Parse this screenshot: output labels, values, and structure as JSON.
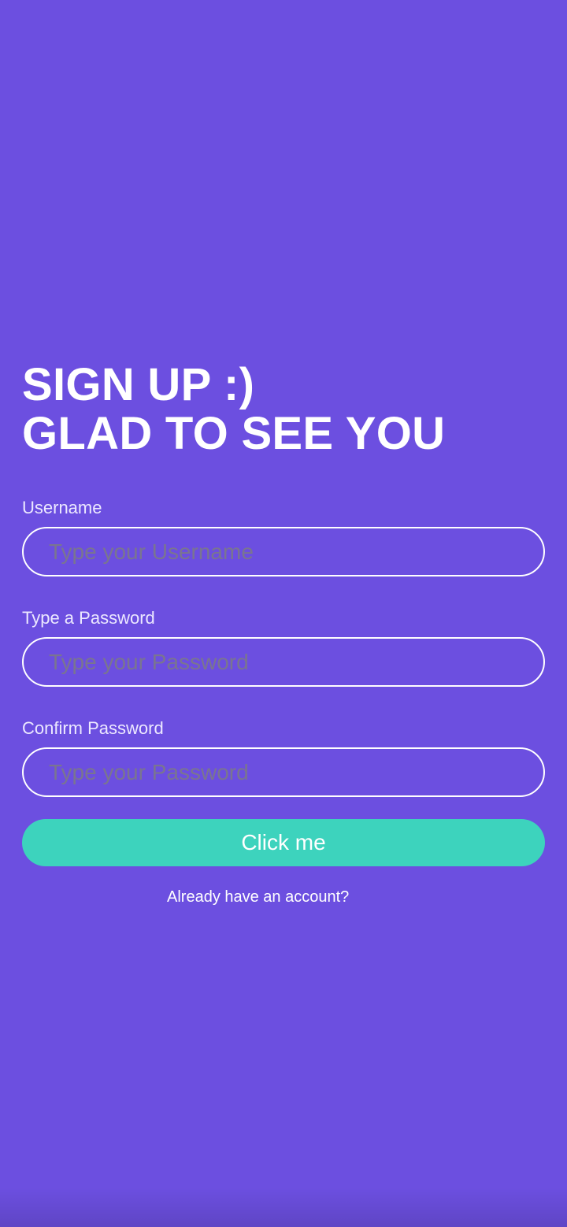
{
  "colors": {
    "background": "#6c4fe0",
    "button": "#3dd3bd",
    "placeholder": "#7a7590",
    "text": "#ffffff"
  },
  "heading": {
    "line1": "SIGN UP :)",
    "line2": "GLAD TO SEE YOU"
  },
  "form": {
    "username": {
      "label": "Username",
      "value": "",
      "placeholder": "Type your Username"
    },
    "password": {
      "label": "Type a Password",
      "value": "",
      "placeholder": "Type your Password"
    },
    "confirm_password": {
      "label": "Confirm Password",
      "value": "",
      "placeholder": "Type your Password"
    },
    "submit_label": "Click me",
    "login_link": "Already have an account?"
  }
}
